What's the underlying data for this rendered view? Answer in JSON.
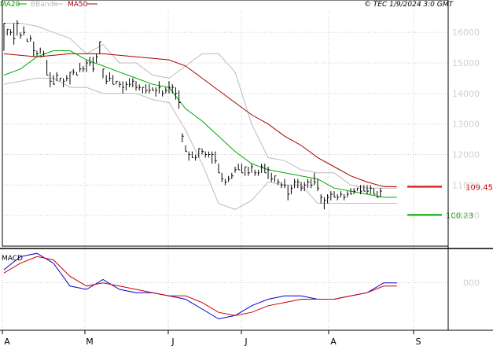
{
  "stamp": "© TEC 1/9/2024 3:0 GMT",
  "legend": {
    "ma20": "MA20",
    "bbands": "BBands",
    "ma50": "MA50"
  },
  "colors": {
    "price": "#000000",
    "ma20": "#00aa00",
    "bbands": "#bbbbbb",
    "ma50": "#aa0000",
    "macd": "#0000cc",
    "signal": "#cc0000",
    "grid": "#cccccc",
    "level_red": "#cc0000",
    "level_green": "#00aa00"
  },
  "chart_data": [
    {
      "type": "ohlc",
      "x": [
        "A",
        "M",
        "J",
        "J",
        "A",
        "S"
      ],
      "y_ticks": [
        "16000",
        "15000",
        "14000",
        "13000",
        "12000",
        "11000",
        "10000"
      ],
      "ylim": [
        9000,
        16700
      ],
      "bars": [
        [
          16300,
          15400,
          16300
        ],
        [
          16100,
          15900,
          16100
        ],
        [
          16100,
          15900,
          16000
        ],
        [
          16300,
          15600,
          15800
        ],
        [
          16400,
          15900,
          16300
        ],
        [
          16000,
          15800,
          15900
        ],
        [
          16200,
          15900,
          16000
        ],
        [
          15800,
          15700,
          15700
        ],
        [
          15900,
          15700,
          15800
        ],
        [
          15700,
          15200,
          15400
        ],
        [
          15400,
          15200,
          15300
        ],
        [
          15500,
          15300,
          15200
        ],
        [
          15400,
          15200,
          15300
        ],
        [
          15100,
          14600,
          14600
        ],
        [
          14700,
          14200,
          14400
        ],
        [
          14600,
          14300,
          14300
        ],
        [
          14700,
          14400,
          14600
        ],
        [
          14500,
          14400,
          14500
        ],
        [
          14500,
          14200,
          14400
        ],
        [
          14600,
          14400,
          14500
        ],
        [
          14700,
          14300,
          14700
        ],
        [
          14800,
          14600,
          14700
        ],
        [
          14700,
          14600,
          14600
        ],
        [
          15000,
          14700,
          14800
        ],
        [
          14900,
          14700,
          14800
        ],
        [
          15100,
          14700,
          15000
        ],
        [
          15200,
          14900,
          15000
        ],
        [
          15200,
          14700,
          14800
        ],
        [
          15300,
          15000,
          15200
        ],
        [
          15700,
          15300,
          15700
        ],
        [
          14800,
          14500,
          14800
        ],
        [
          14600,
          14300,
          14400
        ],
        [
          14700,
          14400,
          14500
        ],
        [
          14600,
          14300,
          14300
        ],
        [
          14400,
          14300,
          14400
        ],
        [
          14400,
          14200,
          14300
        ],
        [
          14400,
          14000,
          14200
        ],
        [
          14400,
          14100,
          14300
        ],
        [
          14500,
          14200,
          14300
        ],
        [
          14500,
          14200,
          14400
        ],
        [
          14400,
          14100,
          14200
        ],
        [
          14300,
          14100,
          14200
        ],
        [
          14200,
          14000,
          14200
        ],
        [
          14300,
          14000,
          14100
        ],
        [
          14300,
          14000,
          14100
        ],
        [
          14200,
          14100,
          14100
        ],
        [
          14200,
          13900,
          14100
        ],
        [
          14400,
          14000,
          14200
        ],
        [
          14100,
          13900,
          14000
        ],
        [
          14200,
          14000,
          14100
        ],
        [
          14400,
          14000,
          14200
        ],
        [
          14300,
          14000,
          14200
        ],
        [
          14200,
          13800,
          14000
        ],
        [
          14100,
          13500,
          13700
        ],
        [
          12700,
          12400,
          12600
        ],
        [
          12300,
          12100,
          12100
        ],
        [
          12100,
          11800,
          12000
        ],
        [
          12100,
          11900,
          11900
        ],
        [
          12000,
          11800,
          11900
        ],
        [
          12200,
          11900,
          12200
        ],
        [
          12200,
          12000,
          12100
        ],
        [
          12100,
          11900,
          12000
        ],
        [
          12100,
          11900,
          12000
        ],
        [
          12100,
          11700,
          12000
        ],
        [
          12100,
          11700,
          11800
        ],
        [
          11700,
          11400,
          11400
        ],
        [
          11400,
          11100,
          11200
        ],
        [
          11200,
          11000,
          11100
        ],
        [
          11300,
          11100,
          11200
        ],
        [
          11400,
          11200,
          11300
        ],
        [
          11600,
          11400,
          11500
        ],
        [
          11700,
          11500,
          11500
        ],
        [
          11700,
          11400,
          11400
        ],
        [
          11600,
          11300,
          11600
        ],
        [
          11600,
          11300,
          11400
        ],
        [
          11700,
          11400,
          11600
        ],
        [
          11500,
          11300,
          11400
        ],
        [
          11500,
          11300,
          11400
        ],
        [
          11700,
          11400,
          11600
        ],
        [
          11700,
          11400,
          11400
        ],
        [
          11600,
          11200,
          11500
        ],
        [
          11400,
          11100,
          11200
        ],
        [
          11300,
          11100,
          11300
        ],
        [
          11200,
          11000,
          11100
        ],
        [
          11100,
          10900,
          11000
        ],
        [
          11200,
          10900,
          11000
        ],
        [
          11000,
          10500,
          10700
        ],
        [
          11000,
          10700,
          10900
        ],
        [
          11200,
          10900,
          11100
        ],
        [
          11200,
          10900,
          11100
        ],
        [
          11100,
          10800,
          10900
        ],
        [
          11100,
          10800,
          11000
        ],
        [
          11200,
          10900,
          11100
        ],
        [
          11200,
          10900,
          11000
        ],
        [
          11400,
          11000,
          11100
        ],
        [
          11200,
          10800,
          10900
        ],
        [
          10700,
          10400,
          10600
        ],
        [
          10600,
          10200,
          10500
        ],
        [
          10700,
          10400,
          10600
        ],
        [
          10800,
          10500,
          10700
        ],
        [
          10800,
          10600,
          10600
        ],
        [
          10700,
          10500,
          10600
        ],
        [
          10800,
          10600,
          10700
        ],
        [
          10700,
          10500,
          10600
        ],
        [
          10800,
          10600,
          10700
        ],
        [
          10900,
          10700,
          10700
        ],
        [
          10900,
          10700,
          10800
        ],
        [
          10900,
          10800,
          10900
        ],
        [
          11000,
          10700,
          10800
        ],
        [
          11000,
          10800,
          10800
        ],
        [
          11000,
          10700,
          10800
        ],
        [
          11000,
          10700,
          10900
        ],
        [
          10900,
          10700,
          10700
        ],
        [
          10800,
          10600,
          10600
        ],
        [
          10900,
          10600,
          10800
        ]
      ],
      "ma20": [
        [
          0,
          14600
        ],
        [
          5,
          14800
        ],
        [
          10,
          15200
        ],
        [
          15,
          15400
        ],
        [
          20,
          15400
        ],
        [
          25,
          15100
        ],
        [
          30,
          14900
        ],
        [
          35,
          14700
        ],
        [
          40,
          14500
        ],
        [
          45,
          14300
        ],
        [
          50,
          14200
        ],
        [
          55,
          13500
        ],
        [
          60,
          13100
        ],
        [
          65,
          12600
        ],
        [
          70,
          12100
        ],
        [
          75,
          11700
        ],
        [
          80,
          11500
        ],
        [
          85,
          11400
        ],
        [
          90,
          11300
        ],
        [
          95,
          11200
        ],
        [
          100,
          10900
        ],
        [
          105,
          10800
        ],
        [
          110,
          10700
        ],
        [
          115,
          10600
        ],
        [
          119,
          10600
        ]
      ],
      "bb_upper": [
        [
          0,
          16300
        ],
        [
          5,
          16300
        ],
        [
          10,
          16200
        ],
        [
          15,
          16000
        ],
        [
          20,
          15800
        ],
        [
          25,
          15300
        ],
        [
          30,
          15600
        ],
        [
          35,
          15000
        ],
        [
          40,
          15000
        ],
        [
          45,
          14600
        ],
        [
          50,
          14500
        ],
        [
          55,
          14900
        ],
        [
          60,
          15300
        ],
        [
          65,
          15300
        ],
        [
          70,
          14700
        ],
        [
          75,
          13000
        ],
        [
          80,
          11900
        ],
        [
          85,
          11800
        ],
        [
          90,
          11500
        ],
        [
          95,
          11400
        ],
        [
          100,
          11400
        ],
        [
          105,
          11000
        ],
        [
          110,
          10900
        ],
        [
          115,
          10900
        ],
        [
          119,
          10900
        ]
      ],
      "bb_lower": [
        [
          0,
          14300
        ],
        [
          5,
          14400
        ],
        [
          10,
          14500
        ],
        [
          15,
          14500
        ],
        [
          20,
          14200
        ],
        [
          25,
          14200
        ],
        [
          30,
          14000
        ],
        [
          35,
          14000
        ],
        [
          40,
          14000
        ],
        [
          45,
          13800
        ],
        [
          50,
          13700
        ],
        [
          55,
          12800
        ],
        [
          60,
          11700
        ],
        [
          65,
          10400
        ],
        [
          70,
          10200
        ],
        [
          75,
          10500
        ],
        [
          80,
          11100
        ],
        [
          85,
          11000
        ],
        [
          90,
          11000
        ],
        [
          95,
          10400
        ],
        [
          100,
          10400
        ],
        [
          105,
          10400
        ],
        [
          110,
          10400
        ],
        [
          115,
          10400
        ],
        [
          119,
          10400
        ]
      ],
      "ma50": [
        [
          0,
          15300
        ],
        [
          10,
          15200
        ],
        [
          20,
          15300
        ],
        [
          30,
          15300
        ],
        [
          40,
          15200
        ],
        [
          50,
          15100
        ],
        [
          55,
          14900
        ],
        [
          60,
          14500
        ],
        [
          65,
          14100
        ],
        [
          70,
          13700
        ],
        [
          75,
          13300
        ],
        [
          80,
          13000
        ],
        [
          85,
          12600
        ],
        [
          90,
          12300
        ],
        [
          95,
          11900
        ],
        [
          100,
          11600
        ],
        [
          105,
          11300
        ],
        [
          110,
          11100
        ],
        [
          115,
          10950
        ],
        [
          119,
          10945
        ]
      ],
      "levels": [
        {
          "value": 10945,
          "label": "109.45",
          "color": "#cc0000"
        },
        {
          "value": 10023,
          "label": "100.23",
          "color": "#00aa00"
        }
      ]
    },
    {
      "type": "line",
      "title": "MACD",
      "x": [
        "A",
        "M",
        "J",
        "J",
        "A",
        "S"
      ],
      "y_ticks": [
        "000"
      ],
      "ylim": [
        -140,
        100
      ],
      "series": [
        {
          "key": "macd",
          "values": [
            [
              0,
              40
            ],
            [
              5,
              80
            ],
            [
              10,
              90
            ],
            [
              15,
              60
            ],
            [
              20,
              -10
            ],
            [
              25,
              -20
            ],
            [
              30,
              10
            ],
            [
              35,
              -20
            ],
            [
              40,
              -30
            ],
            [
              45,
              -30
            ],
            [
              50,
              -40
            ],
            [
              55,
              -50
            ],
            [
              60,
              -80
            ],
            [
              65,
              -110
            ],
            [
              70,
              -100
            ],
            [
              75,
              -70
            ],
            [
              80,
              -50
            ],
            [
              85,
              -40
            ],
            [
              90,
              -40
            ],
            [
              95,
              -50
            ],
            [
              100,
              -50
            ],
            [
              105,
              -40
            ],
            [
              110,
              -30
            ],
            [
              115,
              0
            ],
            [
              119,
              0
            ]
          ]
        },
        {
          "key": "signal",
          "values": [
            [
              0,
              30
            ],
            [
              5,
              60
            ],
            [
              10,
              80
            ],
            [
              15,
              70
            ],
            [
              20,
              20
            ],
            [
              25,
              -10
            ],
            [
              30,
              0
            ],
            [
              35,
              -10
            ],
            [
              40,
              -20
            ],
            [
              45,
              -30
            ],
            [
              50,
              -40
            ],
            [
              55,
              -40
            ],
            [
              60,
              -60
            ],
            [
              65,
              -90
            ],
            [
              70,
              -100
            ],
            [
              75,
              -90
            ],
            [
              80,
              -70
            ],
            [
              85,
              -60
            ],
            [
              90,
              -50
            ],
            [
              95,
              -50
            ],
            [
              100,
              -50
            ],
            [
              105,
              -40
            ],
            [
              110,
              -30
            ],
            [
              115,
              -10
            ],
            [
              119,
              -10
            ]
          ]
        }
      ]
    }
  ]
}
